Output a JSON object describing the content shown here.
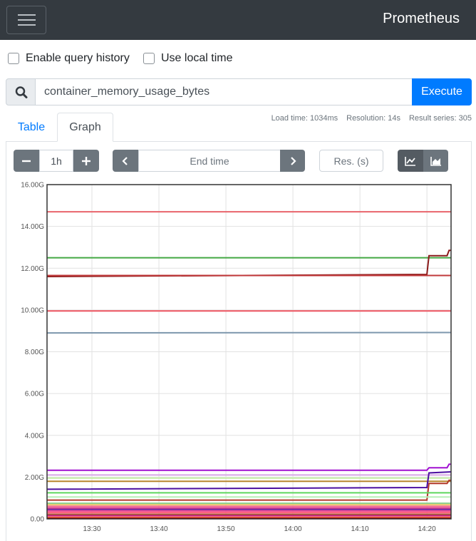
{
  "navbar": {
    "brand": "Prometheus"
  },
  "options": {
    "query_history_label": "Enable query history",
    "local_time_label": "Use local time"
  },
  "query": {
    "value": "container_memory_usage_bytes",
    "execute_label": "Execute"
  },
  "stats": {
    "load_time": "Load time: 1034ms",
    "resolution": "Resolution: 14s",
    "result_series": "Result series: 305"
  },
  "tabs": {
    "table": "Table",
    "graph": "Graph"
  },
  "controls": {
    "range": "1h",
    "end_time_placeholder": "End time",
    "resolution_placeholder": "Res. (s)"
  },
  "colors": {
    "navbar": "#343a40",
    "accent": "#007bff",
    "button": "#6c757d"
  },
  "icons": [
    "menu-icon",
    "search-icon",
    "minus-icon",
    "plus-icon",
    "chevron-left-icon",
    "chevron-right-icon",
    "line-chart-icon",
    "area-chart-icon"
  ],
  "chart_data": {
    "type": "line",
    "ylim": [
      0,
      16
    ],
    "y_ticks": [
      "0.00",
      "2.00G",
      "4.00G",
      "6.00G",
      "8.00G",
      "10.00G",
      "12.00G",
      "14.00G",
      "16.00G"
    ],
    "x_ticks": [
      {
        "label": "13:30",
        "t": 10
      },
      {
        "label": "13:40",
        "t": 20
      },
      {
        "label": "13:50",
        "t": 30
      },
      {
        "label": "14:00",
        "t": 40
      },
      {
        "label": "14:10",
        "t": 50
      },
      {
        "label": "14:20",
        "t": 60
      }
    ],
    "x_range": [
      3.3,
      63.6
    ],
    "grid": true,
    "series": [
      {
        "color": "#e8646b",
        "points": [
          [
            3.3,
            14.7
          ],
          [
            63.6,
            14.7
          ]
        ]
      },
      {
        "color": "#43a843",
        "points": [
          [
            3.3,
            12.5
          ],
          [
            63.6,
            12.5
          ]
        ]
      },
      {
        "color": "#8b1a1a",
        "points": [
          [
            3.3,
            11.6
          ],
          [
            60,
            11.7
          ],
          [
            60.3,
            12.6
          ],
          [
            63,
            12.6
          ],
          [
            63.3,
            12.85
          ],
          [
            63.6,
            12.85
          ]
        ]
      },
      {
        "color": "#c0393b",
        "points": [
          [
            3.3,
            11.65
          ],
          [
            63.6,
            11.65
          ]
        ]
      },
      {
        "color": "#ee5560",
        "points": [
          [
            3.3,
            9.95
          ],
          [
            63.6,
            9.95
          ]
        ]
      },
      {
        "color": "#7d97ad",
        "points": [
          [
            3.3,
            8.9
          ],
          [
            63.6,
            8.92
          ]
        ]
      },
      {
        "color": "#a010d0",
        "points": [
          [
            3.3,
            2.33
          ],
          [
            60,
            2.33
          ],
          [
            60.3,
            2.45
          ],
          [
            63,
            2.45
          ],
          [
            63.3,
            2.62
          ],
          [
            63.6,
            2.62
          ]
        ]
      },
      {
        "color": "#d8a8e8",
        "points": [
          [
            3.3,
            2.1
          ],
          [
            63.6,
            2.1
          ]
        ]
      },
      {
        "color": "#c6efa8",
        "points": [
          [
            3.3,
            1.95
          ],
          [
            63.6,
            1.95
          ]
        ]
      },
      {
        "color": "#b8862e",
        "points": [
          [
            3.3,
            1.8
          ],
          [
            63.6,
            1.8
          ]
        ]
      },
      {
        "color": "#4b0fa0",
        "points": [
          [
            3.3,
            1.42
          ],
          [
            60,
            1.5
          ],
          [
            60.3,
            2.2
          ],
          [
            63.6,
            2.25
          ]
        ]
      },
      {
        "color": "#b33a2a",
        "points": [
          [
            3.3,
            0.9
          ],
          [
            60,
            0.9
          ],
          [
            60.3,
            1.7
          ],
          [
            63,
            1.7
          ],
          [
            63.3,
            1.85
          ],
          [
            63.6,
            1.85
          ]
        ]
      },
      {
        "color": "#5ed65e",
        "points": [
          [
            3.3,
            1.25
          ],
          [
            63.6,
            1.25
          ]
        ]
      },
      {
        "color": "#b6f0b6",
        "points": [
          [
            3.3,
            1.05
          ],
          [
            63.6,
            1.05
          ]
        ]
      },
      {
        "color": "#8fd08f",
        "points": [
          [
            3.3,
            0.75
          ],
          [
            63.6,
            0.75
          ]
        ]
      },
      {
        "color": "#e9c46a",
        "points": [
          [
            3.3,
            0.68
          ],
          [
            63.6,
            0.68
          ]
        ]
      },
      {
        "color": "#f25c8a",
        "points": [
          [
            3.3,
            0.6
          ],
          [
            63.6,
            0.6
          ]
        ]
      },
      {
        "color": "#d63384",
        "points": [
          [
            3.3,
            0.52
          ],
          [
            63.6,
            0.52
          ]
        ]
      },
      {
        "color": "#6a1b9a",
        "points": [
          [
            3.3,
            0.45
          ],
          [
            63.6,
            0.45
          ]
        ]
      },
      {
        "color": "#e83e8c",
        "points": [
          [
            3.3,
            0.38
          ],
          [
            63.6,
            0.38
          ]
        ]
      },
      {
        "color": "#ff4d6d",
        "points": [
          [
            3.3,
            0.3
          ],
          [
            63.6,
            0.3
          ]
        ]
      },
      {
        "color": "#a0522d",
        "points": [
          [
            3.3,
            0.22
          ],
          [
            63.6,
            0.22
          ]
        ]
      },
      {
        "color": "#c71585",
        "points": [
          [
            3.3,
            0.15
          ],
          [
            63.6,
            0.15
          ]
        ]
      },
      {
        "color": "#ff7f50",
        "points": [
          [
            3.3,
            0.08
          ],
          [
            63.6,
            0.08
          ]
        ]
      },
      {
        "color": "#8b0000",
        "points": [
          [
            3.3,
            0.03
          ],
          [
            63.6,
            0.03
          ]
        ]
      }
    ]
  }
}
